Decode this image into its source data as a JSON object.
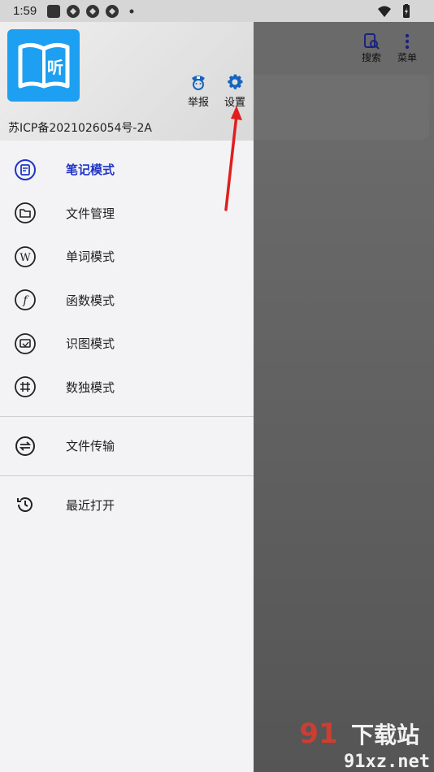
{
  "status_bar": {
    "time": "1:59"
  },
  "background": {
    "actions": [
      {
        "label": "搜索",
        "icon": "search-doc-icon"
      },
      {
        "label": "菜单",
        "icon": "more-vert-icon"
      }
    ]
  },
  "drawer": {
    "logo_text": "听",
    "header_actions": [
      {
        "label": "举报",
        "icon": "police-icon"
      },
      {
        "label": "设置",
        "icon": "gear-icon"
      }
    ],
    "icp": "苏ICP备2021026054号-2A",
    "menu": [
      {
        "label": "笔记模式",
        "icon": "note-icon",
        "active": true
      },
      {
        "label": "文件管理",
        "icon": "folder-icon"
      },
      {
        "label": "单词模式",
        "icon": "word-icon"
      },
      {
        "label": "函数模式",
        "icon": "function-icon"
      },
      {
        "label": "识图模式",
        "icon": "image-recognize-icon"
      },
      {
        "label": "数独模式",
        "icon": "sudoku-icon"
      }
    ],
    "menu2": [
      {
        "label": "文件传输",
        "icon": "transfer-icon"
      }
    ],
    "menu3": [
      {
        "label": "最近打开",
        "icon": "history-icon"
      }
    ]
  },
  "watermark": {
    "text": "91xz.net",
    "sub": "下载站"
  },
  "colors": {
    "accent": "#2034c8",
    "logo": "#1ea0f2",
    "arrow": "#e01e1e"
  }
}
